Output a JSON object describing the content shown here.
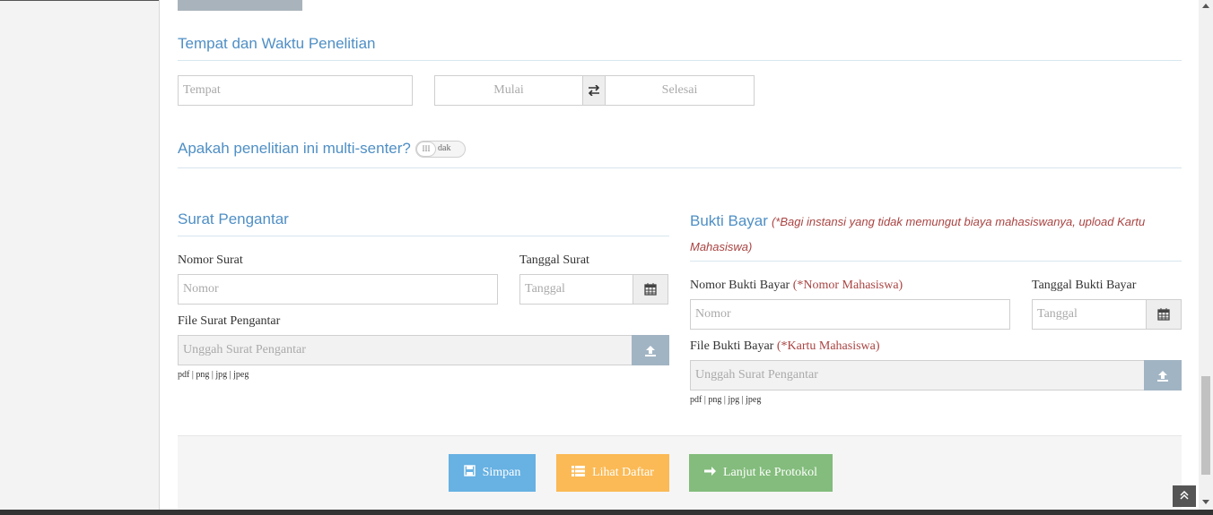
{
  "location": {
    "title": "Tempat dan Waktu Penelitian",
    "place_placeholder": "Tempat",
    "start_placeholder": "Mulai",
    "end_placeholder": "Selesai"
  },
  "multicenter": {
    "question": "Apakah penelitian ini multi-senter?",
    "toggle_knob": "III",
    "toggle_text": "dak"
  },
  "surat": {
    "title": "Surat Pengantar",
    "nomor_label": "Nomor Surat",
    "nomor_placeholder": "Nomor",
    "tanggal_label": "Tanggal Surat",
    "tanggal_placeholder": "Tanggal",
    "file_label": "File Surat Pengantar",
    "file_placeholder": "Unggah Surat Pengantar",
    "file_hint": "pdf | png | jpg | jpeg"
  },
  "bukti": {
    "title": "Bukti Bayar",
    "title_note": "(*Bagi instansi yang tidak memungut biaya mahasiswanya, upload Kartu Mahasiswa)",
    "nomor_label": "Nomor Bukti Bayar",
    "nomor_note": "(*Nomor Mahasiswa)",
    "nomor_placeholder": "Nomor",
    "tanggal_label": "Tanggal Bukti Bayar",
    "tanggal_placeholder": "Tanggal",
    "file_label": "File Bukti Bayar",
    "file_note": "(*Kartu Mahasiswa)",
    "file_placeholder": "Unggah Surat Pengantar",
    "file_hint": "pdf | png | jpg | jpeg"
  },
  "actions": {
    "save": "Simpan",
    "list": "Lihat Daftar",
    "next": "Lanjut ke Protokol"
  },
  "icons": {
    "swap": "swap-icon",
    "calendar": "calendar-icon",
    "upload": "upload-icon",
    "save": "floppy-icon",
    "list": "list-icon",
    "next": "arrow-right-icon",
    "top": "chevron-up-icon"
  }
}
